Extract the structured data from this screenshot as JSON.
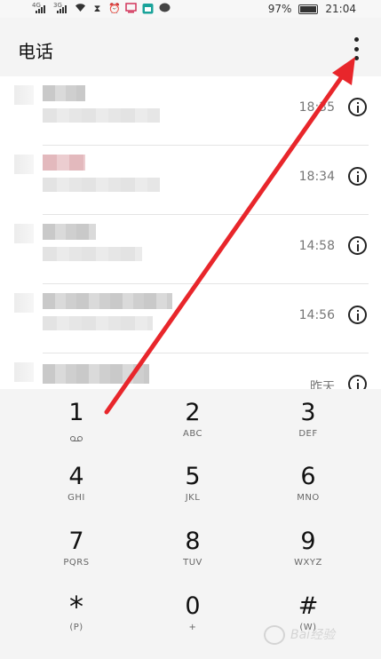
{
  "status_bar": {
    "signal1": "4G",
    "signal2": "3G",
    "battery_percent": "97%",
    "battery_level": 0.97,
    "time": "21:04",
    "icons": [
      "wifi-icon",
      "hourglass-icon",
      "alarm-icon",
      "cast-icon",
      "calendar-icon",
      "chat-bubble-icon"
    ]
  },
  "header": {
    "title": "电话",
    "more_icon": "more-vert-icon"
  },
  "call_log": {
    "items": [
      {
        "time": "18:35",
        "name_color": "#c9c9c9"
      },
      {
        "time": "18:34",
        "name_color": "#e3b9bd"
      },
      {
        "time": "14:58",
        "name_color": "#c9c9c9"
      },
      {
        "time": "14:56",
        "name_color": "#c9c9c9"
      },
      {
        "time": "昨天",
        "name_color": "#c9c9c9"
      }
    ]
  },
  "dialpad": {
    "keys": [
      {
        "digit": "1",
        "letters": "",
        "icon": "voicemail-icon"
      },
      {
        "digit": "2",
        "letters": "ABC"
      },
      {
        "digit": "3",
        "letters": "DEF"
      },
      {
        "digit": "4",
        "letters": "GHI"
      },
      {
        "digit": "5",
        "letters": "JKL"
      },
      {
        "digit": "6",
        "letters": "MNO"
      },
      {
        "digit": "7",
        "letters": "PQRS"
      },
      {
        "digit": "8",
        "letters": "TUV"
      },
      {
        "digit": "9",
        "letters": "WXYZ"
      },
      {
        "digit": "*",
        "letters": "(P)"
      },
      {
        "digit": "0",
        "letters": "+"
      },
      {
        "digit": "#",
        "letters": "(W)"
      }
    ]
  },
  "annotation": {
    "arrow_color": "#e8262b"
  },
  "watermark": {
    "text": "Bai经验"
  }
}
